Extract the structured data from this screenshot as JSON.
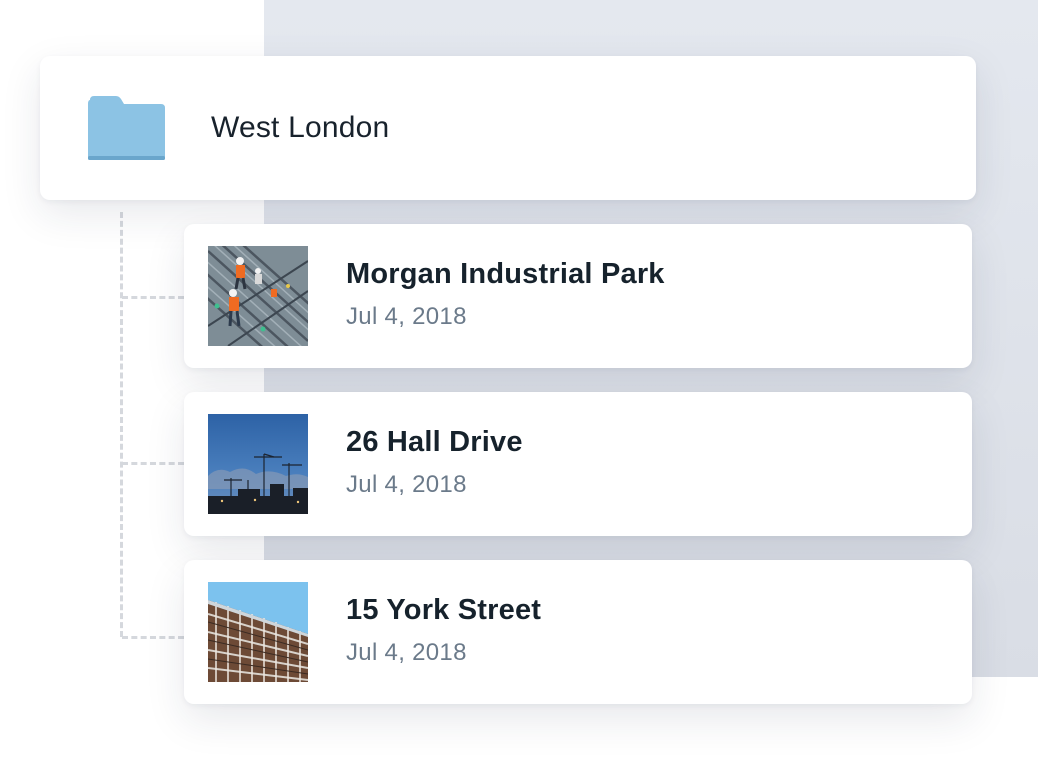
{
  "folder": {
    "name": "West London",
    "icon": "folder-icon",
    "icon_color": "#8cc3e4"
  },
  "projects": [
    {
      "name": "Morgan Industrial Park",
      "date": "Jul 4, 2018",
      "thumbnail": "construction-workers-photo"
    },
    {
      "name": "26 Hall Drive",
      "date": "Jul 4, 2018",
      "thumbnail": "cranes-at-dusk-photo"
    },
    {
      "name": "15 York Street",
      "date": "Jul 4, 2018",
      "thumbnail": "building-frame-photo"
    }
  ],
  "colors": {
    "backdrop": "#e1e5ec",
    "title_text": "#16222c",
    "date_text": "#6b7a8a",
    "connector": "#d5d8dd"
  }
}
